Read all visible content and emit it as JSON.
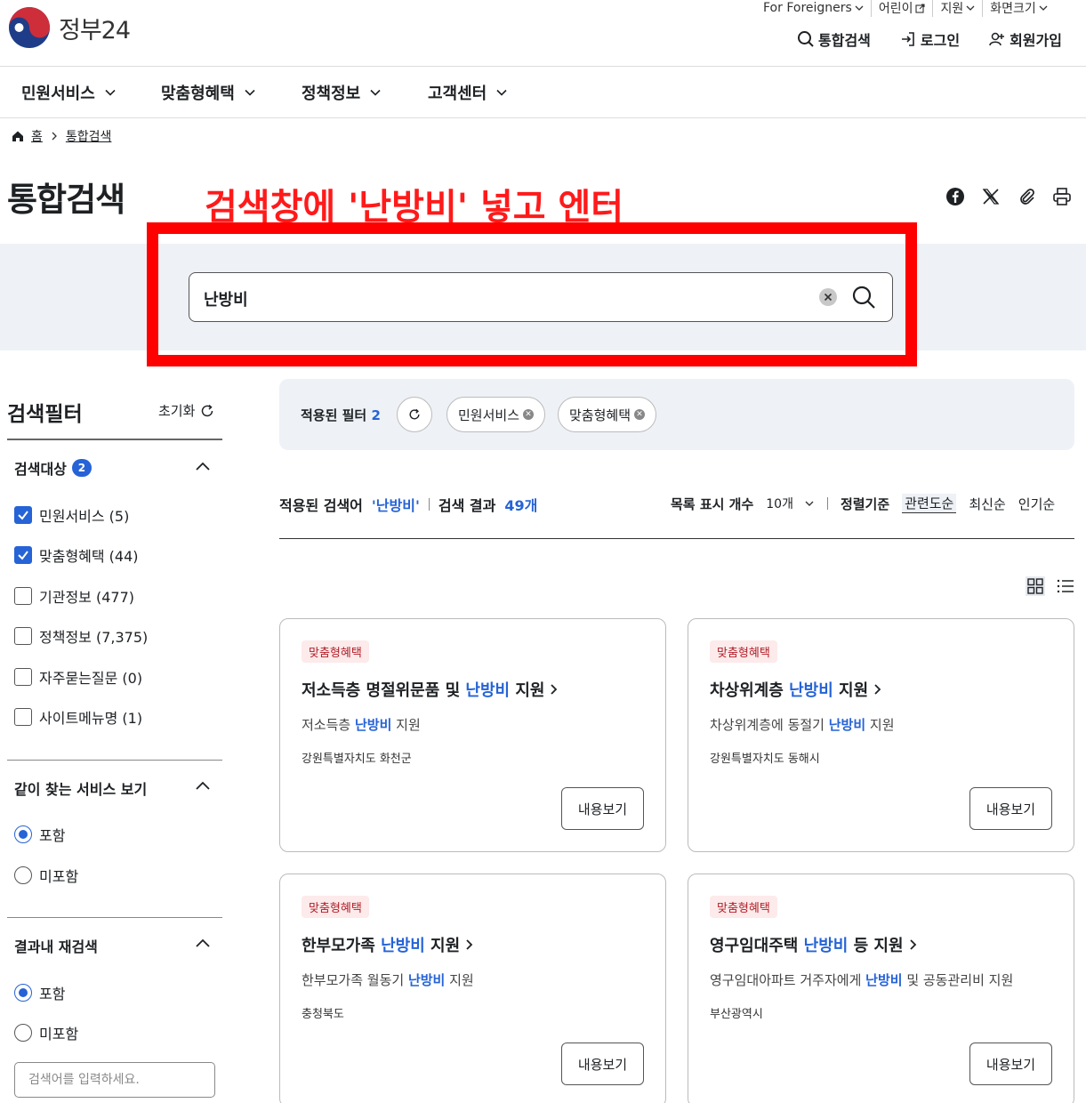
{
  "header": {
    "logo_text": "정부24",
    "utility": [
      {
        "label": "For Foreigners",
        "icon": "chevron-down-icon"
      },
      {
        "label": "어린이",
        "icon": "external-link-icon"
      },
      {
        "label": "지원",
        "icon": "chevron-down-icon"
      },
      {
        "label": "화면크기",
        "icon": "chevron-down-icon"
      }
    ],
    "main_links": {
      "search": "통합검색",
      "login": "로그인",
      "signup": "회원가입"
    }
  },
  "gnb": [
    "민원서비스",
    "맞춤형혜택",
    "정책정보",
    "고객센터"
  ],
  "breadcrumb": {
    "home": "홈",
    "current": "통합검색"
  },
  "page_title": "통합검색",
  "annotation": "검색창에 '난방비' 넣고 엔터",
  "search": {
    "value": "난방비"
  },
  "filter": {
    "title": "검색필터",
    "reset": "초기화",
    "target": {
      "title": "검색대상",
      "count": "2",
      "options": [
        {
          "label": "민원서비스 (5)",
          "checked": true
        },
        {
          "label": "맞춤형혜택 (44)",
          "checked": true
        },
        {
          "label": "기관정보 (477)",
          "checked": false
        },
        {
          "label": "정책정보 (7,375)",
          "checked": false
        },
        {
          "label": "자주묻는질문 (0)",
          "checked": false
        },
        {
          "label": "사이트메뉴명 (1)",
          "checked": false
        }
      ]
    },
    "together": {
      "title": "같이 찾는 서비스 보기",
      "include": "포함",
      "exclude": "미포함"
    },
    "research": {
      "title": "결과내 재검색",
      "include": "포함",
      "exclude": "미포함",
      "placeholder": "검색어를 입력하세요."
    }
  },
  "applied": {
    "label": "적용된 필터",
    "count": "2",
    "chips": [
      "민원서비스",
      "맞춤형혜택"
    ]
  },
  "summary": {
    "term_label": "적용된 검색어",
    "term": "'난방비'",
    "result_label": "검색 결과",
    "result_count": "49개"
  },
  "sort": {
    "page_size_label": "목록 표시 개수",
    "page_size": "10개",
    "sort_label": "정렬기준",
    "options": [
      "관련도순",
      "최신순",
      "인기순"
    ]
  },
  "cards": [
    {
      "tag": "맞춤형혜택",
      "title_pre": "저소득층 명절위문품 및 ",
      "title_hl": "난방비",
      "title_post": " 지원",
      "desc_pre": "저소득층 ",
      "desc_hl": "난방비",
      "desc_post": " 지원",
      "region": "강원특별자치도 화천군",
      "button": "내용보기"
    },
    {
      "tag": "맞춤형혜택",
      "title_pre": "차상위계층 ",
      "title_hl": "난방비",
      "title_post": " 지원",
      "desc_pre": "차상위계층에 동절기 ",
      "desc_hl": "난방비",
      "desc_post": " 지원",
      "region": "강원특별자치도 동해시",
      "button": "내용보기"
    },
    {
      "tag": "맞춤형혜택",
      "title_pre": "한부모가족 ",
      "title_hl": "난방비",
      "title_post": " 지원",
      "desc_pre": "한부모가족 월동기 ",
      "desc_hl": "난방비",
      "desc_post": " 지원",
      "region": "충청북도",
      "button": "내용보기"
    },
    {
      "tag": "맞춤형혜택",
      "title_pre": "영구임대주택 ",
      "title_hl": "난방비",
      "title_post": " 등 지원",
      "desc_pre": "영구임대아파트 거주자에게 ",
      "desc_hl": "난방비",
      "desc_post": " 및 공동관리비 지원",
      "region": "부산광역시",
      "button": "내용보기"
    }
  ],
  "colors": {
    "accent": "#2563d6",
    "annotation": "#ff0000",
    "tag_bg": "#fdeaea"
  }
}
